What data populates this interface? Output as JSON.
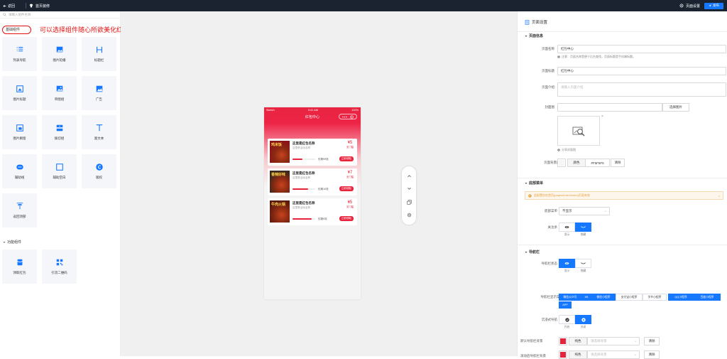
{
  "topbar": {
    "back_label": "返回",
    "page_title": "首页装修",
    "settings_label": "页面设置",
    "publish_label": "发布"
  },
  "left": {
    "search_placeholder": "请输入组件名称",
    "basic_section": "基础组件",
    "annotation": "可以选择组件随心所欲美化红包中心页面",
    "basic_items": [
      {
        "label": "列表导航",
        "icon": "list-icon"
      },
      {
        "label": "图片轮播",
        "icon": "image-carousel-icon"
      },
      {
        "label": "标题栏",
        "icon": "heading-icon"
      },
      {
        "label": "图片标题",
        "icon": "image-title-icon"
      },
      {
        "label": "单图组",
        "icon": "single-image-icon"
      },
      {
        "label": "广告",
        "icon": "ad-icon"
      },
      {
        "label": "图片橱窗",
        "icon": "image-window-icon"
      },
      {
        "label": "拨切组",
        "icon": "split-group-icon"
      },
      {
        "label": "富文本",
        "icon": "text-icon"
      },
      {
        "label": "辅助线",
        "icon": "guide-line-icon"
      },
      {
        "label": "辅助空白",
        "icon": "blank-space-icon"
      },
      {
        "label": "版权",
        "icon": "copyright-icon"
      },
      {
        "label": "返回顶部",
        "icon": "back-to-top-icon"
      }
    ],
    "func_section": "功能组件",
    "func_items": [
      {
        "label": "领取红包",
        "icon": "red-packet-icon"
      },
      {
        "label": "引流二维码",
        "icon": "qrcode-icon"
      }
    ]
  },
  "phone": {
    "carrier": "Sketch",
    "time": "9:41 AM",
    "battery": "100%",
    "title": "红包中心",
    "cards": [
      {
        "title": "这里是红包名称",
        "sub": "这里是活动名称",
        "price": "¥5",
        "price_sub": "无门槛",
        "progress": 0.45,
        "remain": "仅剩99张",
        "btn": "立即领取",
        "img_text": "鸡米饭"
      },
      {
        "title": "这里是红包名称",
        "sub": "这里是活动名称",
        "price": "¥7",
        "price_sub": "无门槛",
        "progress": 0.7,
        "remain": "仅剩10张",
        "btn": "立即领取",
        "img_text": "香辣好味"
      },
      {
        "title": "这里是红包名称",
        "sub": "这里是活动名称",
        "price": "¥5",
        "price_sub": "无门槛",
        "progress": 0.85,
        "remain": "仅剩0张",
        "btn": "立即领取",
        "img_text": "牛肉火锅"
      }
    ]
  },
  "right": {
    "header": "页面设置",
    "g_info": "页面信息",
    "name_label": "页面名称",
    "name_value": "红包中心",
    "name_hint": "注意：页面名称是便于后台查找，页面标题是手机端标题。",
    "title_label": "页面标题",
    "title_value": "红包中心",
    "intro_label": "页面介绍",
    "intro_placeholder": "请输入页面介绍",
    "cover_label": "封面图",
    "cover_btn": "选择图片",
    "cover_hint": "分享封面图",
    "bg_label": "页面背景颜色",
    "bg_pure": "颜色",
    "bg_value": "#F5F5F5",
    "bg_clear": "清除",
    "bg_swatch": "#f5f5f5",
    "g_bottom": "底部菜单",
    "bottom_alert": "此配置仅在首页(pages/index/index)页面有效",
    "menu_label": "底部菜单",
    "menu_value": "不显示",
    "follow_label": "关注条",
    "follow_opts": [
      "显示",
      "隐藏"
    ],
    "g_nav": "导航栏",
    "nav_state_label": "导航栏状态",
    "nav_state_opts": [
      "显示",
      "隐藏"
    ],
    "channel_label": "导航栏显示渠道",
    "channels": [
      "微信公众号",
      "H5",
      "微信小程序",
      "支付宝小程序",
      "字节小程序",
      "QQ小程序",
      "百度小程序",
      "APP"
    ],
    "immersive_label": "沉浸式导航",
    "immersive_opts": [
      "开启",
      "关闭"
    ],
    "def_bg_label": "默认导航栏背景",
    "def_bg_pure": "纯色",
    "def_bg_ph": "请选择背景",
    "def_bg_clear": "清除",
    "scroll_bg_label": "滚动后导航栏背景",
    "scroll_bg_pure": "纯色",
    "scroll_bg_ph": "请选择背景",
    "scroll_bg_clear": "清除",
    "accent": "#e8243c",
    "primary": "#1677ff"
  }
}
